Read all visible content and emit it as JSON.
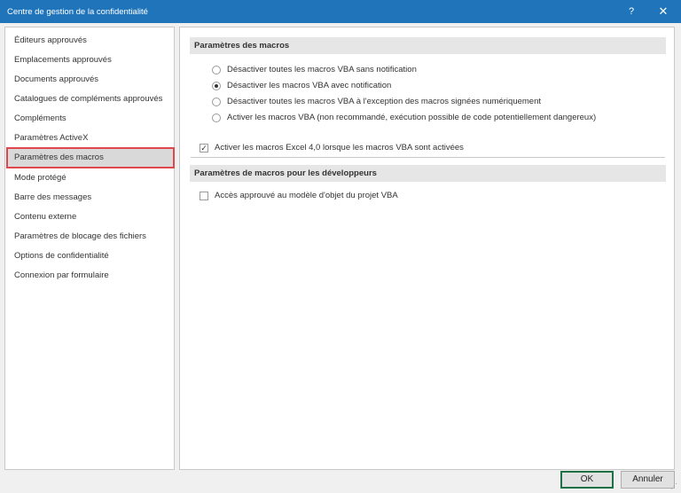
{
  "window": {
    "title": "Centre de gestion de la confidentialité",
    "help_glyph": "?",
    "close_glyph": "✕"
  },
  "sidebar": {
    "items": [
      {
        "label": "Éditeurs approuvés"
      },
      {
        "label": "Emplacements approuvés"
      },
      {
        "label": "Documents approuvés"
      },
      {
        "label": "Catalogues de compléments approuvés"
      },
      {
        "label": "Compléments"
      },
      {
        "label": "Paramètres ActiveX"
      },
      {
        "label": "Paramètres des macros",
        "selected": true
      },
      {
        "label": "Mode protégé"
      },
      {
        "label": "Barre des messages"
      },
      {
        "label": "Contenu externe"
      },
      {
        "label": "Paramètres de blocage des fichiers"
      },
      {
        "label": "Options de confidentialité"
      },
      {
        "label": "Connexion par formulaire"
      }
    ]
  },
  "macros": {
    "header": "Paramètres des macros",
    "options": [
      {
        "label": "Désactiver toutes les macros VBA sans notification",
        "checked": false
      },
      {
        "label": "Désactiver les macros VBA avec notification",
        "checked": true
      },
      {
        "label": "Désactiver toutes les macros VBA à l'exception des macros signées numériquement",
        "checked": false
      },
      {
        "label": "Activer les macros VBA (non recommandé, exécution possible de code potentiellement dangereux)",
        "checked": false
      }
    ],
    "excel4": {
      "label": "Activer les macros Excel 4,0 lorsque les macros VBA sont activées",
      "checked": true
    }
  },
  "developer": {
    "header": "Paramètres de macros pour les développeurs",
    "vba_access": {
      "label": "Accès approuvé au modèle d'objet du projet VBA",
      "checked": false
    }
  },
  "buttons": {
    "ok": "OK",
    "cancel": "Annuler"
  },
  "colors": {
    "titlebar": "#1f74ba",
    "selection_outline": "#e0474c",
    "ok_border": "#1e7145"
  }
}
